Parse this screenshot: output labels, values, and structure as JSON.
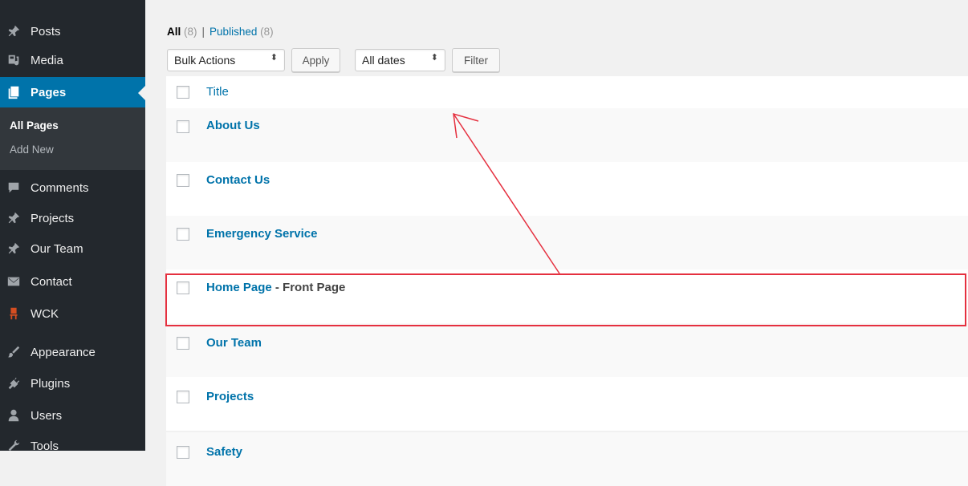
{
  "sidebar": {
    "items": [
      {
        "label": "Posts",
        "icon": "pin-icon"
      },
      {
        "label": "Media",
        "icon": "media-icon"
      },
      {
        "label": "Pages",
        "icon": "pages-icon",
        "current": true
      },
      {
        "label": "Comments",
        "icon": "comment-icon"
      },
      {
        "label": "Projects",
        "icon": "pin-icon"
      },
      {
        "label": "Our Team",
        "icon": "pin-icon"
      },
      {
        "label": "Contact",
        "icon": "mail-icon"
      },
      {
        "label": "WCK",
        "icon": "chair-icon"
      },
      {
        "label": "Appearance",
        "icon": "brush-icon"
      },
      {
        "label": "Plugins",
        "icon": "plug-icon"
      },
      {
        "label": "Users",
        "icon": "user-icon"
      },
      {
        "label": "Tools",
        "icon": "wrench-icon"
      }
    ],
    "submenu": {
      "all_pages": "All Pages",
      "add_new": "Add New"
    }
  },
  "filters": {
    "all_label": "All",
    "all_count": "(8)",
    "separator": "|",
    "published_label": "Published",
    "published_count": "(8)"
  },
  "toolbar": {
    "bulk_actions": "Bulk Actions",
    "apply": "Apply",
    "all_dates": "All dates",
    "filter": "Filter",
    "select_arrows": "⬍"
  },
  "table": {
    "header_title": "Title",
    "rows": [
      {
        "title": "About Us",
        "state": ""
      },
      {
        "title": "Contact Us",
        "state": ""
      },
      {
        "title": "Emergency Service",
        "state": ""
      },
      {
        "title": "Home Page",
        "state": " - Front Page"
      },
      {
        "title": "Our Team",
        "state": ""
      },
      {
        "title": "Projects",
        "state": ""
      },
      {
        "title": "Safety",
        "state": ""
      }
    ]
  },
  "colors": {
    "sidebar_bg": "#23282d",
    "accent": "#0073aa",
    "annotation": "#e5303f"
  }
}
